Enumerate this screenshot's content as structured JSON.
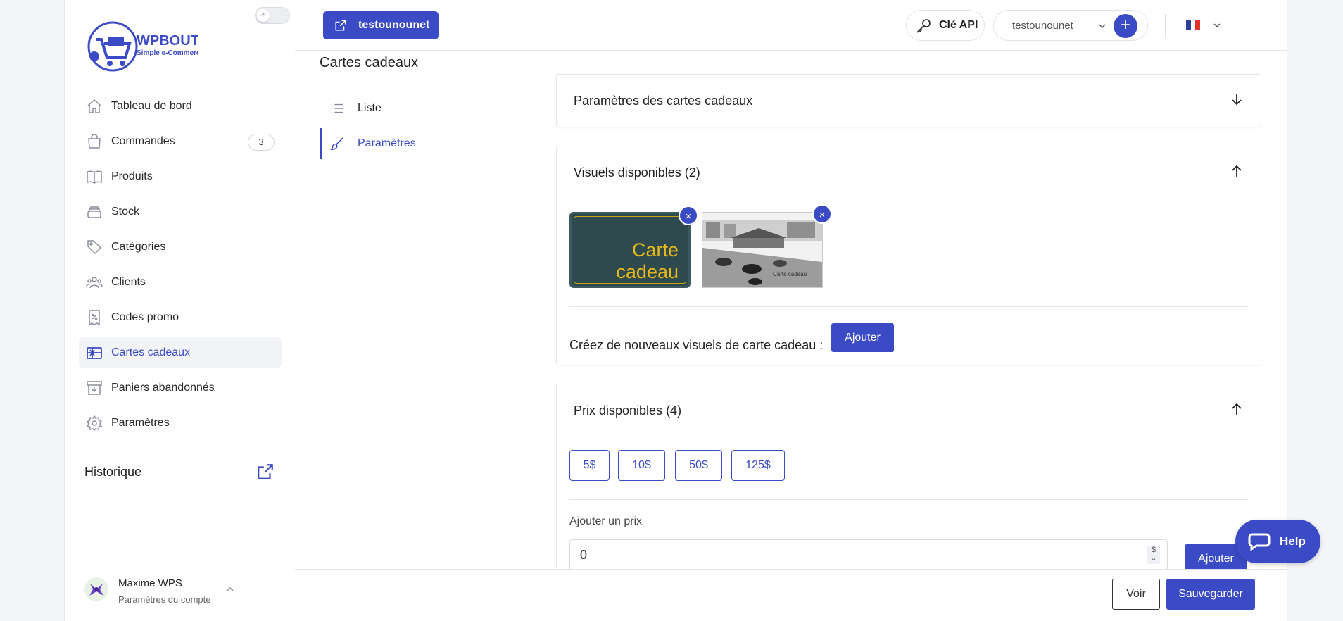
{
  "brand": {
    "name": "WPBOUTIK",
    "tagline": "Simple e-Commerce"
  },
  "sidebar": {
    "items": [
      {
        "label": "Tableau de bord",
        "icon": "home-icon"
      },
      {
        "label": "Commandes",
        "icon": "bag-icon",
        "badge": "3"
      },
      {
        "label": "Produits",
        "icon": "book-icon"
      },
      {
        "label": "Stock",
        "icon": "stack-icon"
      },
      {
        "label": "Catégories",
        "icon": "tag-icon"
      },
      {
        "label": "Clients",
        "icon": "users-icon"
      },
      {
        "label": "Codes promo",
        "icon": "receipt-percent-icon"
      },
      {
        "label": "Cartes cadeaux",
        "icon": "gift-card-icon",
        "active": true
      },
      {
        "label": "Paniers abandonnés",
        "icon": "archive-icon"
      },
      {
        "label": "Paramètres",
        "icon": "gear-icon"
      }
    ],
    "history_label": "Historique",
    "user": {
      "name": "Maxime WPS",
      "subtitle": "Paramètres du compte"
    }
  },
  "topbar": {
    "store_button": "testounounet",
    "api_button": "Clé API",
    "shop_select": "testounounet",
    "add_symbol": "+",
    "language": "fr"
  },
  "page": {
    "title": "Cartes cadeaux",
    "subnav": [
      {
        "label": "Liste",
        "icon": "list-icon"
      },
      {
        "label": "Paramètres",
        "icon": "brush-icon",
        "active": true
      }
    ]
  },
  "panels": {
    "settings": {
      "title": "Paramètres des cartes cadeaux"
    },
    "visuals": {
      "title": "Visuels disponibles (2)",
      "card1_line1": "Carte",
      "card1_line2": "cadeau",
      "card2_caption": "Carte cadeau",
      "create_label": "Créez de nouveaux visuels de carte cadeau :",
      "add_button": "Ajouter",
      "remove_symbol": "×"
    },
    "prices": {
      "title": "Prix disponibles (4)",
      "values": [
        "5$",
        "10$",
        "50$",
        "125$"
      ],
      "add_label": "Ajouter un prix",
      "input_value": "0",
      "currency": "$",
      "add_button": "Ajouter"
    }
  },
  "footer": {
    "view_button": "Voir",
    "save_button": "Sauvegarder"
  },
  "help": {
    "label": "Help"
  },
  "colors": {
    "accent": "#3b4bc6",
    "card_bg": "#2f4a4e",
    "card_text": "#e7b817"
  }
}
